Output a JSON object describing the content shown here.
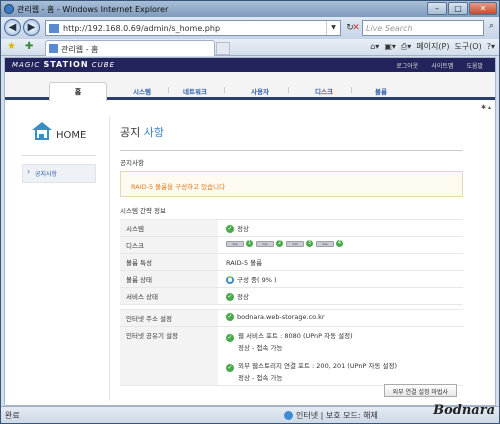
{
  "window": {
    "title": "관리웹 - 홈 - Windows Internet Explorer"
  },
  "browser": {
    "url": "http://192.168.0.69/admin/s_home.php",
    "search_placeholder": "Live Search",
    "tab_title": "관리웹 - 홈",
    "commands": {
      "page": "페이지(P)",
      "tools": "도구(O)"
    }
  },
  "site": {
    "logo_small": "MAGIC",
    "logo_main": "STATION",
    "logo_suffix": "CUBE",
    "top_links": [
      "로그아웃",
      "사이트맵",
      "도움말"
    ],
    "menu": {
      "home": "홈",
      "items": [
        "시스템",
        "네트워크",
        "사용자",
        "디스크",
        "볼륨"
      ]
    }
  },
  "sidebar": {
    "home_label": "HOME",
    "items": [
      {
        "label": "공지사항"
      }
    ]
  },
  "main": {
    "title_prefix": "공지",
    "title_highlight": "사항",
    "notice_heading": "공지사항",
    "notice_text": "RAID-5 볼륨을 구성하고 있습니다",
    "info_heading": "시스템 간략 정보",
    "rows": {
      "system": {
        "label": "시스템",
        "value": "정상"
      },
      "disk": {
        "label": "디스크",
        "disks": [
          "1",
          "2",
          "3",
          "4"
        ],
        "disk_caption": "disk"
      },
      "volume_type": {
        "label": "볼륨 특성",
        "value": "RAID-5 볼륨"
      },
      "volume_status": {
        "label": "볼륨 상태",
        "value": "구성 중( 9% )"
      },
      "service": {
        "label": "서비스 상태",
        "value": "정상"
      },
      "internet_addr": {
        "label": "인터넷 주소 설정",
        "value": "bodnara.web-storage.co.kr"
      },
      "sharing": {
        "label": "인터넷 공유기 설정",
        "web_service": "웹 서비스 포트 : 8080 (UPnP 자동 설정)",
        "web_status": "정상 - 접속 가능",
        "storage_service": "외부 웹스토리지 연결 포트 : 200, 201 (UPnP 자동 설정)",
        "storage_status": "정상 - 접속 가능"
      }
    },
    "wizard_button": "외부 연결 설정 마법사"
  },
  "status": {
    "left": "완료",
    "zone": "인터넷 | 보호 모드: 해제",
    "watermark": "Bodnara"
  },
  "colors": {
    "accent": "#3b7fc6",
    "nav_band": "#24245c",
    "notice_text": "#e07b1e",
    "ok_green": "#4aa94a"
  }
}
